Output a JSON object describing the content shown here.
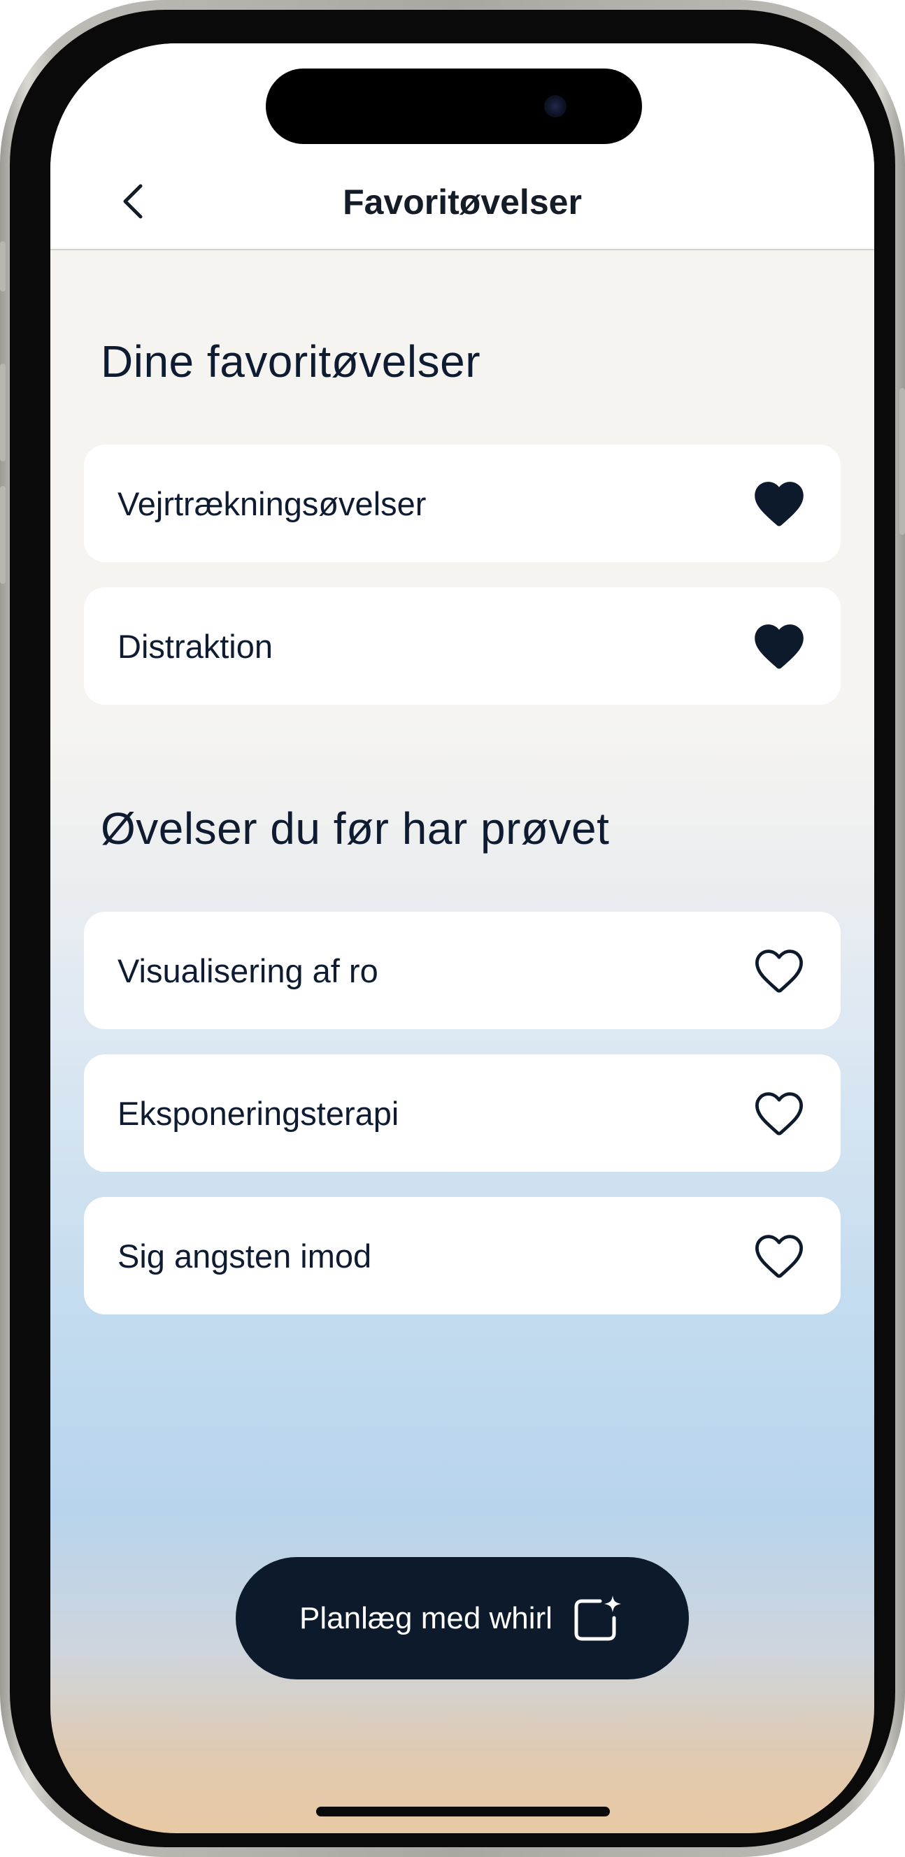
{
  "header": {
    "title": "Favoritøvelser"
  },
  "favorites": {
    "title": "Dine favoritøvelser",
    "items": [
      {
        "label": "Vejrtrækningsøvelser",
        "favorited": true
      },
      {
        "label": "Distraktion",
        "favorited": true
      }
    ]
  },
  "tried": {
    "title": "Øvelser du før har prøvet",
    "items": [
      {
        "label": "Visualisering af ro",
        "favorited": false
      },
      {
        "label": "Eksponeringsterapi",
        "favorited": false
      },
      {
        "label": "Sig angsten imod",
        "favorited": false
      }
    ]
  },
  "cta": {
    "label": "Planlæg med whirl",
    "icon": "sparkle-square-icon"
  },
  "colors": {
    "primary": "#0c1a2c",
    "text": "#0e1b30",
    "card": "#ffffff",
    "background": "#f5f4f1"
  }
}
